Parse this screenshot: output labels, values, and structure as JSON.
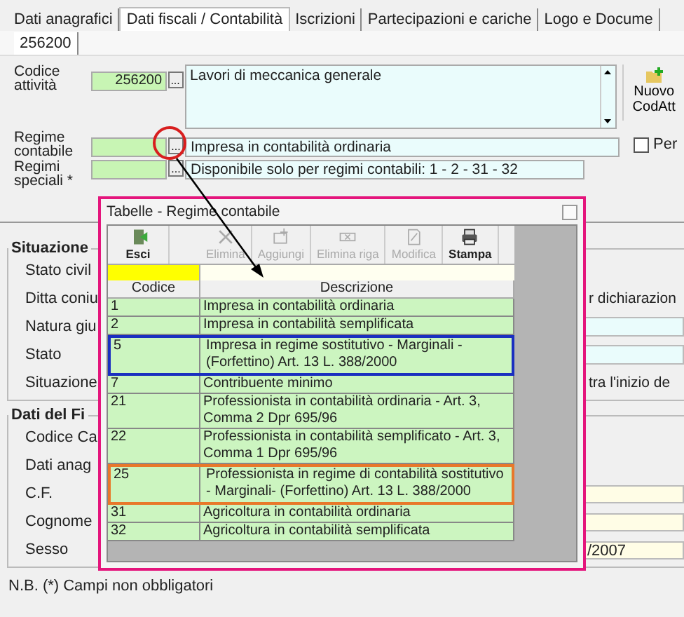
{
  "tabs": [
    {
      "label": "Dati anagrafici",
      "selected": false
    },
    {
      "label": "Dati fiscali / Contabilità",
      "selected": true
    },
    {
      "label": "Iscrizioni",
      "selected": false
    },
    {
      "label": "Partecipazioni e cariche",
      "selected": false
    },
    {
      "label": "Logo e Docume",
      "selected": false
    }
  ],
  "subtabs": [
    {
      "label": "256200",
      "selected": true
    }
  ],
  "codice_attivita": {
    "label": "Codice attività",
    "code": "256200",
    "button": "...",
    "description": "Lavori di meccanica generale"
  },
  "nuovo_button": "Nuovo CodAtt",
  "regime_contabile": {
    "label": "Regime contabile",
    "button": "...",
    "description": "Impresa  in contabilità ordinaria"
  },
  "per_checkbox": {
    "label": "Per",
    "checked": false
  },
  "regimi_speciali": {
    "label": "Regimi speciali *",
    "button": "...",
    "description": "Disponibile solo per regimi contabili: 1 - 2 - 31 - 32"
  },
  "groups": [
    {
      "title": "Situazione",
      "rows": [
        {
          "label": "Stato civil",
          "kind": "plain"
        },
        {
          "label": "Ditta coniu",
          "kind": "text",
          "value": "r dichiarazion"
        },
        {
          "label": "Natura giu",
          "kind": "field"
        },
        {
          "label": "Stato",
          "kind": "field"
        },
        {
          "label": "Situazione",
          "kind": "text",
          "value": "tra l'inizio de"
        }
      ]
    },
    {
      "title": "Dati del Fi",
      "rows": [
        {
          "label": "Codice Ca",
          "kind": "plain"
        },
        {
          "label": "Dati anag",
          "kind": "plain"
        },
        {
          "label": "C.F.",
          "kind": "input"
        },
        {
          "label": "Cognome",
          "kind": "input"
        },
        {
          "label": "Sesso",
          "kind": "input",
          "value": "/2007"
        }
      ]
    }
  ],
  "note": "N.B. (*) Campi non obbligatori",
  "dialog": {
    "title": "Tabelle - Regime contabile",
    "toolbar": [
      {
        "label": "Esci",
        "kind": "exit",
        "disabled": false
      },
      {
        "label": "Elimina",
        "kind": "delete",
        "disabled": true
      },
      {
        "label": "Aggiungi",
        "kind": "add",
        "disabled": true
      },
      {
        "label": "Elimina riga",
        "kind": "delete_row",
        "disabled": true
      },
      {
        "label": "Modifica",
        "kind": "edit",
        "disabled": true
      },
      {
        "label": "Stampa",
        "kind": "print",
        "disabled": false
      }
    ],
    "columns": [
      "Codice",
      "Descrizione"
    ],
    "rows": [
      {
        "code": "1",
        "description": "Impresa  in contabilità ordinaria"
      },
      {
        "code": "2",
        "description": "Impresa  in contabilità semplificata"
      },
      {
        "code": "5",
        "description": "Impresa in regime sostitutivo - Marginali - (Forfettino) Art. 13 L. 388/2000",
        "color": "#1a2fc0"
      },
      {
        "code": "7",
        "description": "Contribuente minimo"
      },
      {
        "code": "21",
        "description": "Professionista in contabilità ordinaria - Art. 3, Comma 2 Dpr 695/96"
      },
      {
        "code": "22",
        "description": "Professionista in contabilità semplificato - Art. 3, Comma 1 Dpr 695/96"
      },
      {
        "code": "25",
        "description": "Professionista in regime di contabilità sostitutivo - Marginali- (Forfettino) Art. 13 L. 388/2000",
        "color": "#e8782a"
      },
      {
        "code": "31",
        "description": "Agricoltura in contabilità ordinaria"
      },
      {
        "code": "32",
        "description": "Agricoltura in contabilità semplificata"
      }
    ]
  }
}
